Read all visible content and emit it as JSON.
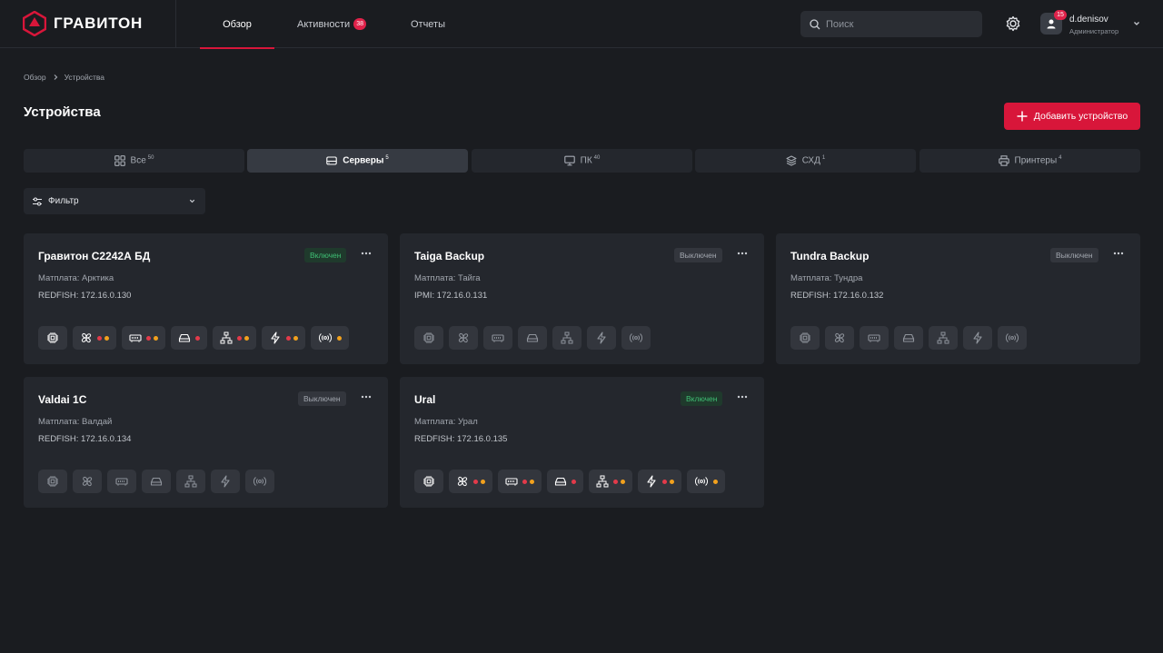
{
  "header": {
    "brand_name": "ГРАВИТОН",
    "nav": [
      {
        "label": "Обзор",
        "badge": ""
      },
      {
        "label": "Активности",
        "badge": "38"
      },
      {
        "label": "Отчеты",
        "badge": ""
      }
    ],
    "search_placeholder": "Поиск",
    "user": {
      "name": "d.denisov",
      "role": "Администратор",
      "notifications": "15"
    }
  },
  "breadcrumb": [
    "Обзор",
    "Устройства"
  ],
  "page_title": "Устройства",
  "add_button_label": "Добавить устройство",
  "category_tabs": [
    {
      "label": "Все",
      "count": "50"
    },
    {
      "label": "Серверы",
      "count": "5"
    },
    {
      "label": "ПК",
      "count": "40"
    },
    {
      "label": "СХД",
      "count": "1"
    },
    {
      "label": "Принтеры",
      "count": "4"
    }
  ],
  "filter_label": "Фильтр",
  "colors": {
    "accent": "#d8163a",
    "on": "#3fbf74",
    "dot_red": "#e33a4a",
    "dot_orange": "#f2a11d"
  },
  "devices": [
    {
      "name": "Гравитон С2242А БД",
      "status": "Включен",
      "board": "Матплата: Арктика",
      "address": "REDFISH: 172.16.0.130"
    },
    {
      "name": "Taiga Backup",
      "status": "Выключен",
      "board": "Матплата: Тайга",
      "address": "IPMI: 172.16.0.131"
    },
    {
      "name": "Tundra Backup",
      "status": "Выключен",
      "board": "Матплата: Тундра",
      "address": "REDFISH: 172.16.0.132"
    },
    {
      "name": "Valdai 1C",
      "status": "Выключен",
      "board": "Матплата: Валдай",
      "address": "REDFISH: 172.16.0.134"
    },
    {
      "name": "Ural",
      "status": "Включен",
      "board": "Матплата: Урал",
      "address": "REDFISH: 172.16.0.135"
    }
  ],
  "component_icons": [
    "cpu-icon",
    "fan-icon",
    "memory-icon",
    "storage-icon",
    "network-icon",
    "power-icon",
    "sensor-icon"
  ]
}
